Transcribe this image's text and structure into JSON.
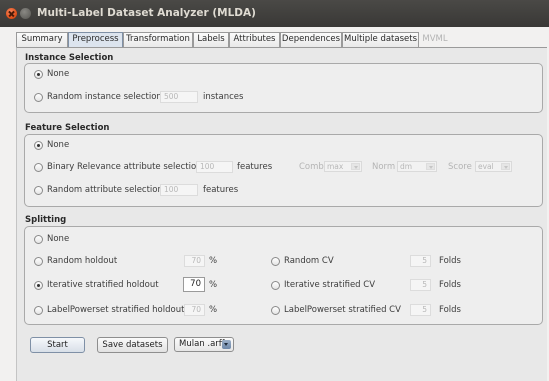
{
  "window": {
    "title": "Multi-Label Dataset Analyzer (MLDA)",
    "close_icon": "close-icon",
    "minimize_icon": "minimize-icon"
  },
  "tabs": [
    {
      "label": "Summary"
    },
    {
      "label": "Preprocess",
      "active": true
    },
    {
      "label": "Transformation"
    },
    {
      "label": "Labels"
    },
    {
      "label": "Attributes"
    },
    {
      "label": "Dependences"
    },
    {
      "label": "Multiple datasets"
    },
    {
      "label": "MVML",
      "disabled": true
    }
  ],
  "instance_selection": {
    "title": "Instance Selection",
    "none_label": "None",
    "none_selected": true,
    "random_label": "Random instance selection",
    "random_value": "500",
    "random_unit": "instances"
  },
  "feature_selection": {
    "title": "Feature Selection",
    "none_label": "None",
    "none_selected": true,
    "br_label": "Binary Relevance attribute selection",
    "br_value": "100",
    "br_unit": "features",
    "comb_label": "Comb",
    "comb_value": "max",
    "norm_label": "Norm",
    "norm_value": "dm",
    "score_label": "Score",
    "score_value": "eval",
    "random_label": "Random attribute selection",
    "random_value": "100",
    "random_unit": "features"
  },
  "splitting": {
    "title": "Splitting",
    "none_label": "None",
    "random_holdout_label": "Random holdout",
    "random_holdout_value": "70",
    "percent": "%",
    "iterative_holdout_label": "Iterative stratified holdout",
    "iterative_holdout_value": "70",
    "iterative_holdout_selected": true,
    "lp_holdout_label": "LabelPowerset stratified holdout",
    "lp_holdout_value": "70",
    "random_cv_label": "Random CV",
    "random_cv_value": "5",
    "iterative_cv_label": "Iterative stratified CV",
    "iterative_cv_value": "5",
    "lp_cv_label": "LabelPowerset stratified CV",
    "lp_cv_value": "5",
    "folds": "Folds"
  },
  "actions": {
    "start_label": "Start",
    "save_label": "Save datasets",
    "format_value": "Mulan .arff"
  }
}
